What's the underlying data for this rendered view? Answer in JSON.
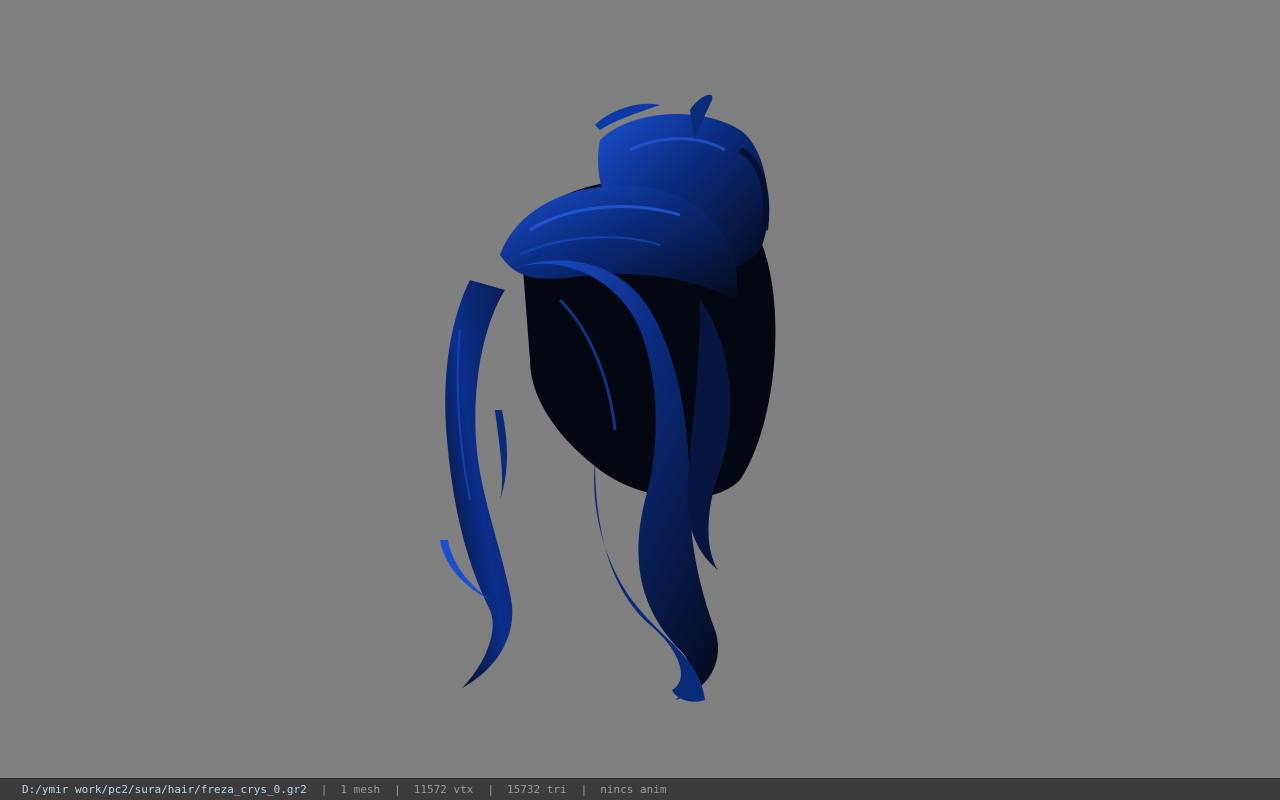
{
  "viewport": {
    "background_color": "#808080",
    "model": {
      "name": "hair-model",
      "color_dark": "#050a1a",
      "color_mid": "#0a2a7a",
      "color_highlight": "#1a50d0"
    }
  },
  "status_bar": {
    "file_path": "D:/ymir work/pc2/sura/hair/freza_crys_0.gr2",
    "separator": "|",
    "mesh_count": "1 mesh",
    "vertex_count": "11572 vtx",
    "triangle_count": "15732 tri",
    "anim_status": "nincs anim"
  }
}
